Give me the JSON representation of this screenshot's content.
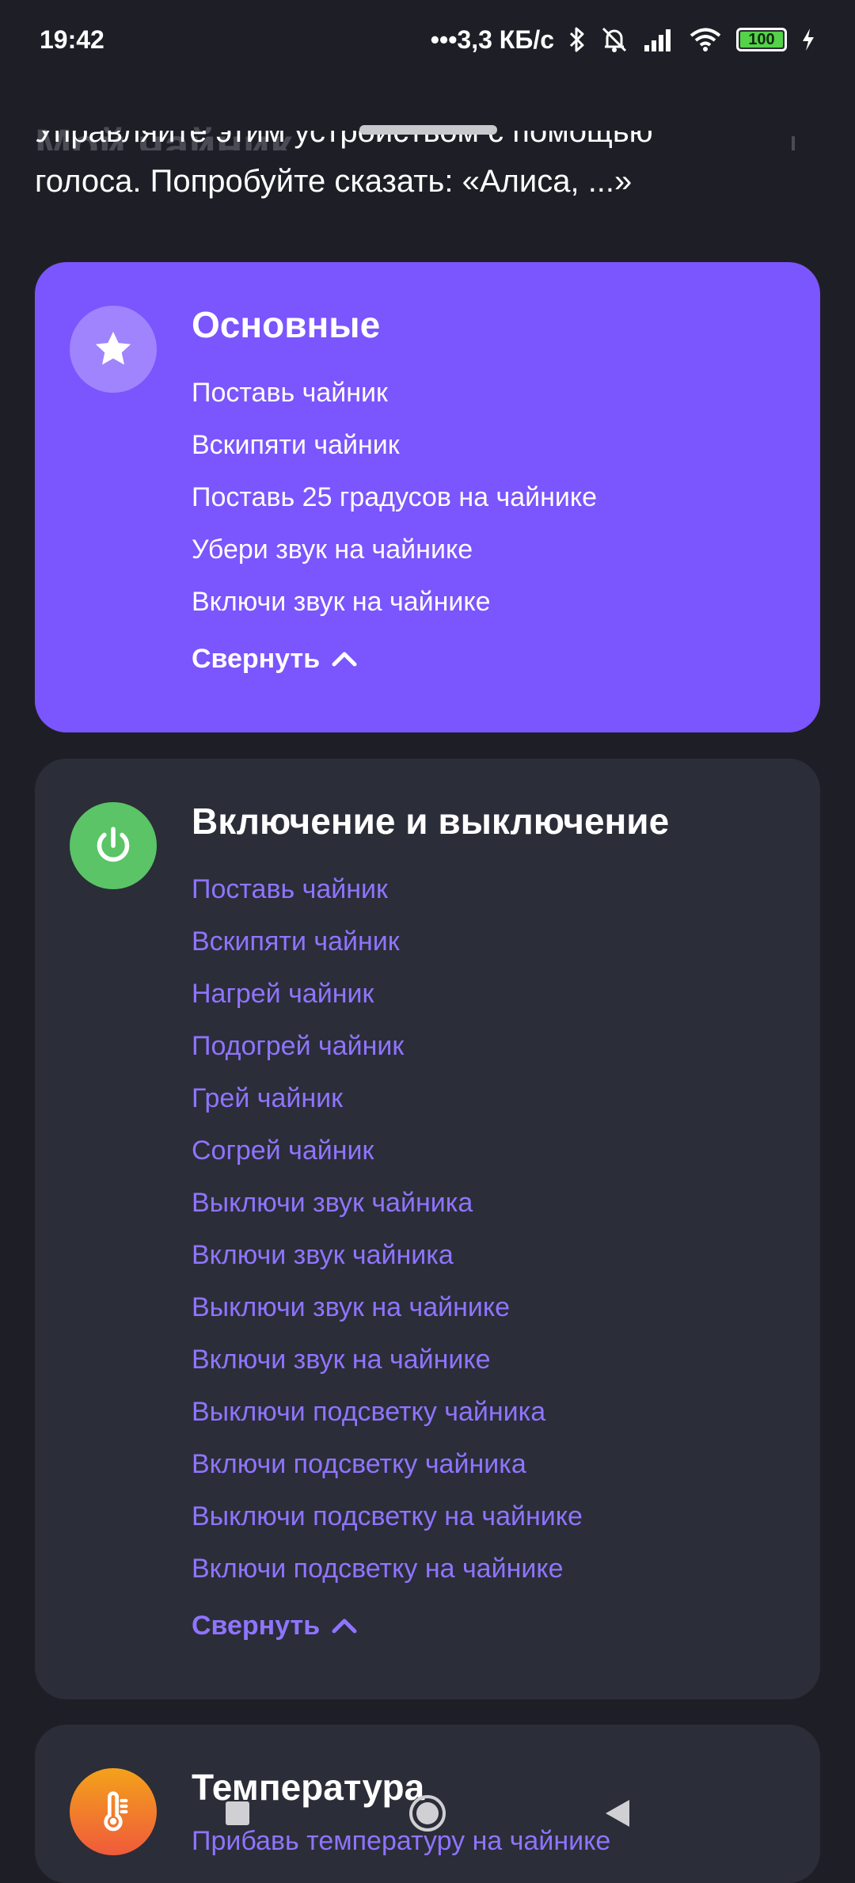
{
  "status_bar": {
    "time": "19:42",
    "network_speed": "•••3,3 КБ/с",
    "battery_level": "100",
    "icons": [
      "bluetooth-icon",
      "alarm-off-icon",
      "signal-icon",
      "wifi-icon",
      "battery-icon",
      "charging-icon"
    ]
  },
  "background": {
    "title": "Мой чайник"
  },
  "intro": {
    "line1": "Управляйте этим устройством с помощью",
    "line2": "голоса. Попробуйте сказать: «Алиса, ...»"
  },
  "sections": {
    "main": {
      "title": "Основные",
      "icon": "star-icon",
      "commands": [
        "Поставь чайник",
        "Вскипяти чайник",
        "Поставь 25 градусов на чайнике",
        "Убери звук на чайнике",
        "Включи звук на чайнике"
      ],
      "collapse_label": "Свернуть"
    },
    "power": {
      "title": "Включение и выключение",
      "icon": "power-icon",
      "commands": [
        "Поставь чайник",
        "Вскипяти чайник",
        "Нагрей чайник",
        "Подогрей чайник",
        "Грей чайник",
        "Согрей чайник",
        "Выключи звук чайника",
        "Включи звук чайника",
        "Выключи звук на чайнике",
        "Включи звук на чайнике",
        "Выключи подсветку чайника",
        "Включи подсветку чайника",
        "Выключи подсветку на чайнике",
        "Включи подсветку на чайнике"
      ],
      "collapse_label": "Свернуть"
    },
    "temperature": {
      "title": "Температура",
      "icon": "thermometer-icon",
      "first_command": "Прибавь температуру на чайнике"
    }
  },
  "colors": {
    "main_card": "#7b55fd",
    "dark_card": "#2b2d38",
    "accent_text": "#8f74ff",
    "power_icon_bg": "#5ac466"
  }
}
